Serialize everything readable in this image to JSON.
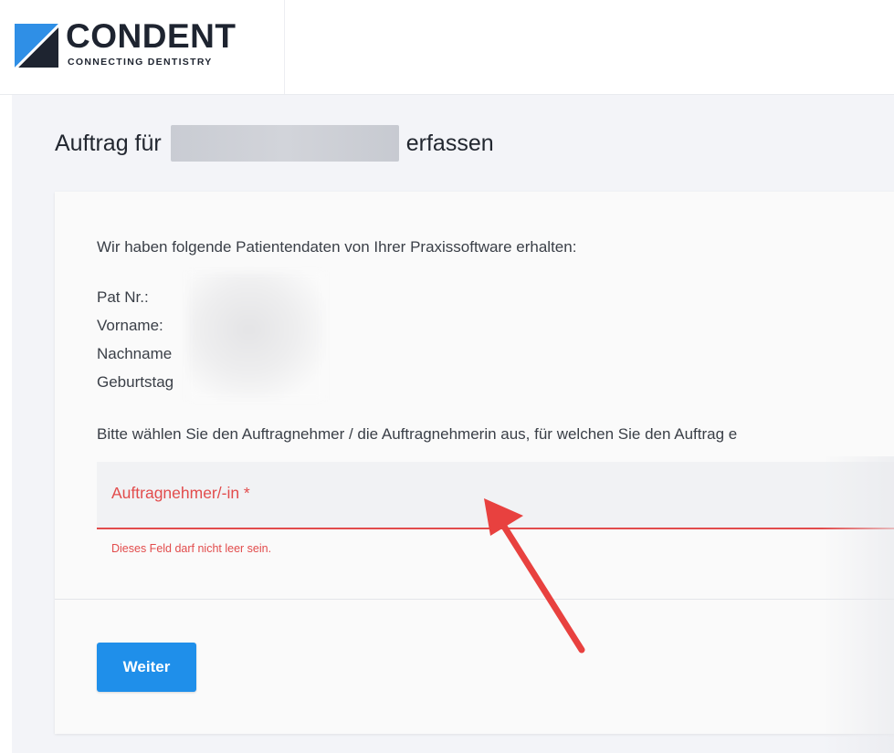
{
  "brand": {
    "name": "CONDENT",
    "tagline": "CONNECTING DENTISTRY",
    "colors": {
      "mark": "#2f8fe6",
      "text": "#1e2430"
    }
  },
  "page": {
    "title_prefix": "Auftrag für",
    "title_suffix": "erfassen"
  },
  "card": {
    "intro": "Wir haben folgende Patientendaten von Ihrer Praxissoftware erhalten:",
    "patient_labels": [
      "Pat Nr.:",
      "Vorname:",
      "Nachname",
      "Geburtstag"
    ],
    "select_prompt": "Bitte wählen Sie den Auftragnehmer / die Auftragnehmerin aus, für welchen Sie den Auftrag e",
    "field": {
      "label": "Auftragnehmer/-in *",
      "error": "Dieses Feld darf nicht leer sein."
    },
    "submit_label": "Weiter"
  },
  "colors": {
    "error": "#e24c4c",
    "primary_button": "#1f8fea",
    "annotation_arrow": "#e8413f"
  },
  "icons": [
    "condent-logo-icon",
    "annotation-arrow-icon"
  ]
}
